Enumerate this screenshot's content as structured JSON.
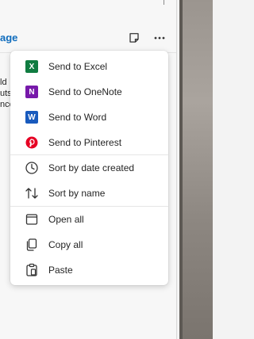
{
  "page_link": "age",
  "bg_lines": [
    "ld",
    "uts",
    "nce"
  ],
  "header": {
    "note_icon": "sticky-note-icon",
    "more_icon": "more-horizontal-icon"
  },
  "menu": {
    "send_excel": "Send to Excel",
    "send_onenote": "Send to OneNote",
    "send_word": "Send to Word",
    "send_pinterest": "Send to Pinterest",
    "sort_date": "Sort by date created",
    "sort_name": "Sort by name",
    "open_all": "Open all",
    "copy_all": "Copy all",
    "paste": "Paste"
  },
  "colors": {
    "excel": "#107c41",
    "onenote": "#7719aa",
    "word": "#185abd",
    "pinterest": "#e60023",
    "link": "#0f6cbd"
  }
}
